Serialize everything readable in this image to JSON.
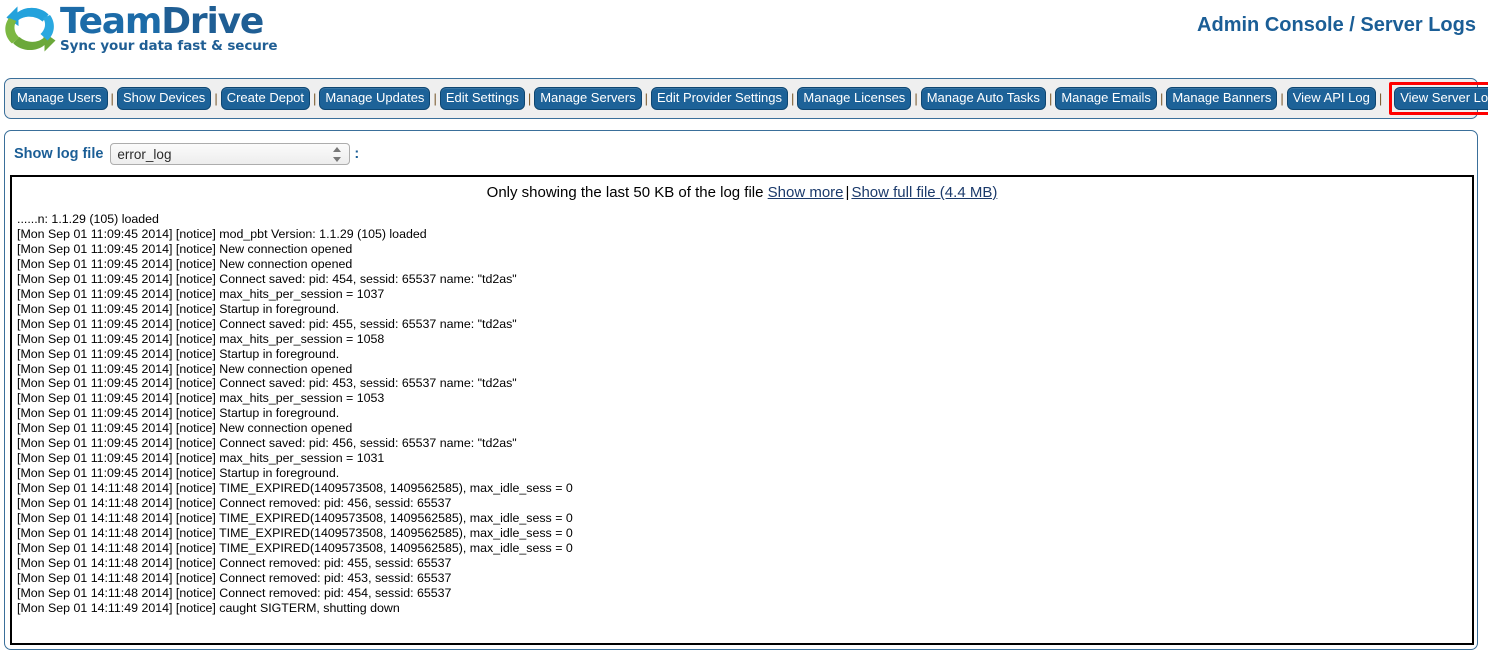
{
  "header": {
    "logo_title_part1": "Team",
    "logo_title_part2": "Drive",
    "logo_tagline": "Sync your data fast & secure",
    "logo_icon": "sync-arrows-icon",
    "console_title": "Admin Console / Server Logs",
    "brand_blue": "#1c6ba8",
    "brand_dark_blue": "#1b5e96",
    "brand_green": "#7ab648"
  },
  "nav": {
    "separator": "|",
    "items": [
      {
        "label": "Manage Users",
        "highlighted": false
      },
      {
        "label": "Show Devices",
        "highlighted": false
      },
      {
        "label": "Create Depot",
        "highlighted": false
      },
      {
        "label": "Manage Updates",
        "highlighted": false
      },
      {
        "label": "Edit Settings",
        "highlighted": false
      },
      {
        "label": "Manage Servers",
        "highlighted": false
      },
      {
        "label": "Edit Provider Settings",
        "highlighted": false
      },
      {
        "label": "Manage Licenses",
        "highlighted": false
      },
      {
        "label": "Manage Auto Tasks",
        "highlighted": false
      },
      {
        "label": "Manage Emails",
        "highlighted": false
      },
      {
        "label": "Manage Banners",
        "highlighted": false
      },
      {
        "label": "View API Log",
        "highlighted": false
      },
      {
        "label": "View Server Logs",
        "highlighted": true
      }
    ],
    "highlight_color": "#ff0000",
    "button_color": "#1d6298"
  },
  "logfile": {
    "label": "Show log file",
    "selected": "error_log",
    "colon": ":",
    "options": [
      "error_log"
    ]
  },
  "log": {
    "notice_prefix": "Only showing the last 50 KB of the log file",
    "show_more_label": "Show more",
    "separator": "|",
    "show_full_label": "Show full file (4.4 MB)",
    "lines": [
      "......n: 1.1.29 (105) loaded",
      "[Mon Sep 01 11:09:45 2014] [notice] mod_pbt Version: 1.1.29 (105) loaded",
      "[Mon Sep 01 11:09:45 2014] [notice] New connection opened",
      "[Mon Sep 01 11:09:45 2014] [notice] New connection opened",
      "[Mon Sep 01 11:09:45 2014] [notice] Connect saved: pid: 454, sessid: 65537 name: \"td2as\"",
      "[Mon Sep 01 11:09:45 2014] [notice] max_hits_per_session = 1037",
      "[Mon Sep 01 11:09:45 2014] [notice] Startup in foreground.",
      "[Mon Sep 01 11:09:45 2014] [notice] Connect saved: pid: 455, sessid: 65537 name: \"td2as\"",
      "[Mon Sep 01 11:09:45 2014] [notice] max_hits_per_session = 1058",
      "[Mon Sep 01 11:09:45 2014] [notice] Startup in foreground.",
      "[Mon Sep 01 11:09:45 2014] [notice] New connection opened",
      "[Mon Sep 01 11:09:45 2014] [notice] Connect saved: pid: 453, sessid: 65537 name: \"td2as\"",
      "[Mon Sep 01 11:09:45 2014] [notice] max_hits_per_session = 1053",
      "[Mon Sep 01 11:09:45 2014] [notice] Startup in foreground.",
      "[Mon Sep 01 11:09:45 2014] [notice] New connection opened",
      "[Mon Sep 01 11:09:45 2014] [notice] Connect saved: pid: 456, sessid: 65537 name: \"td2as\"",
      "[Mon Sep 01 11:09:45 2014] [notice] max_hits_per_session = 1031",
      "[Mon Sep 01 11:09:45 2014] [notice] Startup in foreground.",
      "[Mon Sep 01 14:11:48 2014] [notice] TIME_EXPIRED(1409573508, 1409562585), max_idle_sess = 0",
      "[Mon Sep 01 14:11:48 2014] [notice] Connect removed: pid: 456, sessid: 65537",
      "[Mon Sep 01 14:11:48 2014] [notice] TIME_EXPIRED(1409573508, 1409562585), max_idle_sess = 0",
      "[Mon Sep 01 14:11:48 2014] [notice] TIME_EXPIRED(1409573508, 1409562585), max_idle_sess = 0",
      "[Mon Sep 01 14:11:48 2014] [notice] TIME_EXPIRED(1409573508, 1409562585), max_idle_sess = 0",
      "[Mon Sep 01 14:11:48 2014] [notice] Connect removed: pid: 455, sessid: 65537",
      "[Mon Sep 01 14:11:48 2014] [notice] Connect removed: pid: 453, sessid: 65537",
      "[Mon Sep 01 14:11:48 2014] [notice] Connect removed: pid: 454, sessid: 65537",
      "[Mon Sep 01 14:11:49 2014] [notice] caught SIGTERM, shutting down"
    ]
  }
}
